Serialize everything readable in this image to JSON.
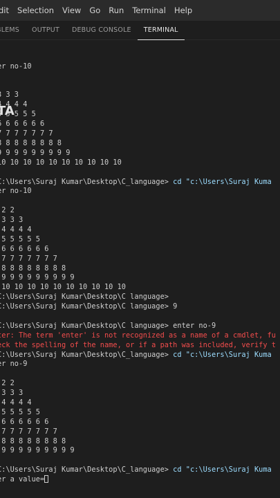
{
  "menu": [
    "dit",
    "Selection",
    "View",
    "Go",
    "Run",
    "Terminal",
    "Help"
  ],
  "tabs": [
    "BLEMS",
    "OUTPUT",
    "DEBUG CONSOLE",
    "TERMINAL"
  ],
  "active_tab": "TERMINAL",
  "overlay_glyph": "TA",
  "terminal_lines": [
    {
      "t": "er no-10"
    },
    {
      "t": ""
    },
    {
      "t": ""
    },
    {
      "t": "3 3 3"
    },
    {
      "t": "4 4 4 4"
    },
    {
      "t": "5 5 5 5 5"
    },
    {
      "t": "6 6 6 6 6 6"
    },
    {
      "t": "7 7 7 7 7 7 7"
    },
    {
      "t": "8 8 8 8 8 8 8 8"
    },
    {
      "t": "9 9 9 9 9 9 9 9 9"
    },
    {
      "t": "10 10 10 10 10 10 10 10 10 10"
    },
    {
      "t": ""
    },
    {
      "t": "C:\\Users\\Suraj Kumar\\Desktop\\C_language> ",
      "c": "cd \"c:\\Users\\Suraj Kuma"
    },
    {
      "t": "er no-10"
    },
    {
      "t": ""
    },
    {
      "t": " 2 2"
    },
    {
      "t": " 3 3 3"
    },
    {
      "t": " 4 4 4 4"
    },
    {
      "t": " 5 5 5 5 5"
    },
    {
      "t": " 6 6 6 6 6 6"
    },
    {
      "t": " 7 7 7 7 7 7 7"
    },
    {
      "t": " 8 8 8 8 8 8 8 8"
    },
    {
      "t": " 9 9 9 9 9 9 9 9 9"
    },
    {
      "t": " 10 10 10 10 10 10 10 10 10 10"
    },
    {
      "t": "C:\\Users\\Suraj Kumar\\Desktop\\C language>"
    },
    {
      "t": "C:\\Users\\Suraj Kumar\\Desktop\\C language> 9"
    },
    {
      "t": ""
    },
    {
      "t": "C:\\Users\\Suraj Kumar\\Desktop\\C language> enter no-9"
    },
    {
      "t": "ter: The term 'enter' is not recognized as a name of a cmdlet, fu",
      "e": true
    },
    {
      "t": "eck the spelling of the name, or if a path was included, verify t",
      "e": true
    },
    {
      "t": "C:\\Users\\Suraj Kumar\\Desktop\\C_language> ",
      "c": "cd \"c:\\Users\\Suraj Kuma"
    },
    {
      "t": "er no-9"
    },
    {
      "t": ""
    },
    {
      "t": " 2 2"
    },
    {
      "t": " 3 3 3"
    },
    {
      "t": " 4 4 4 4"
    },
    {
      "t": " 5 5 5 5 5"
    },
    {
      "t": " 6 6 6 6 6 6"
    },
    {
      "t": " 7 7 7 7 7 7 7"
    },
    {
      "t": " 8 8 8 8 8 8 8 8"
    },
    {
      "t": " 9 9 9 9 9 9 9 9 9"
    },
    {
      "t": ""
    },
    {
      "t": "C:\\Users\\Suraj Kumar\\Desktop\\C_language> ",
      "c": "cd \"c:\\Users\\Suraj Kuma"
    },
    {
      "t": "er a value=",
      "cursor": true
    }
  ]
}
